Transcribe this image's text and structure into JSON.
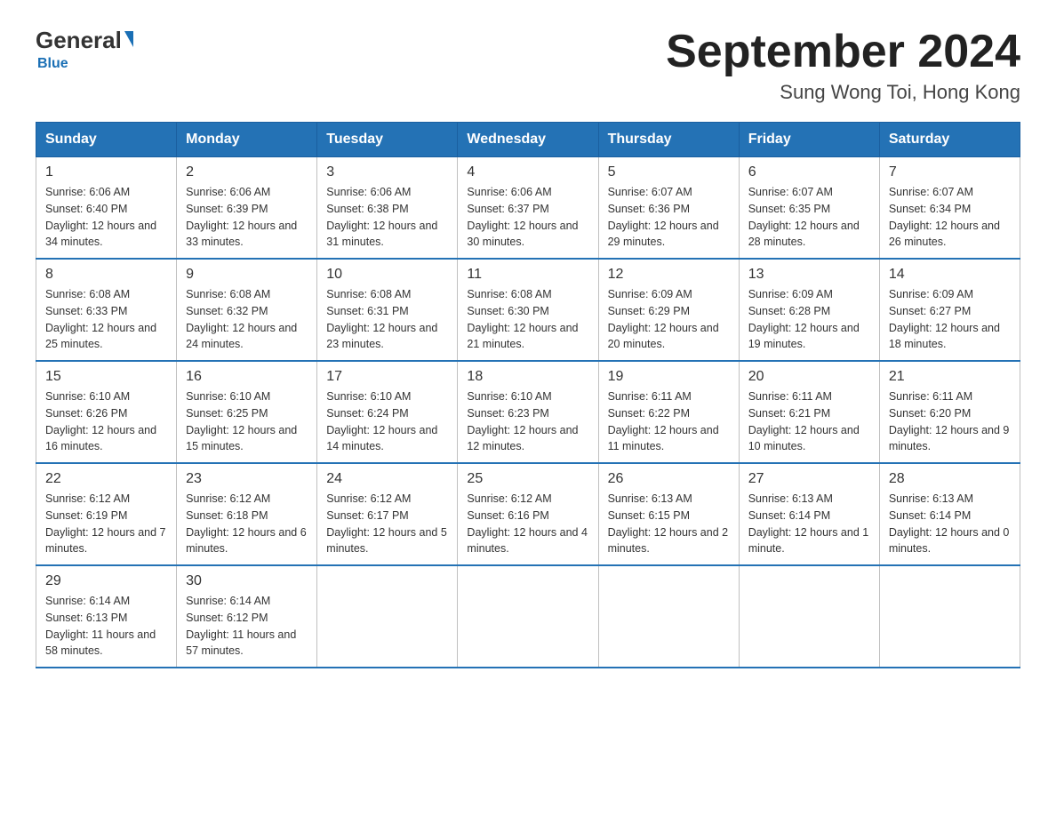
{
  "header": {
    "logo_general": "General",
    "logo_blue": "Blue",
    "month_year": "September 2024",
    "location": "Sung Wong Toi, Hong Kong"
  },
  "weekdays": [
    "Sunday",
    "Monday",
    "Tuesday",
    "Wednesday",
    "Thursday",
    "Friday",
    "Saturday"
  ],
  "weeks": [
    [
      {
        "day": "1",
        "sunrise": "6:06 AM",
        "sunset": "6:40 PM",
        "daylight": "12 hours and 34 minutes."
      },
      {
        "day": "2",
        "sunrise": "6:06 AM",
        "sunset": "6:39 PM",
        "daylight": "12 hours and 33 minutes."
      },
      {
        "day": "3",
        "sunrise": "6:06 AM",
        "sunset": "6:38 PM",
        "daylight": "12 hours and 31 minutes."
      },
      {
        "day": "4",
        "sunrise": "6:06 AM",
        "sunset": "6:37 PM",
        "daylight": "12 hours and 30 minutes."
      },
      {
        "day": "5",
        "sunrise": "6:07 AM",
        "sunset": "6:36 PM",
        "daylight": "12 hours and 29 minutes."
      },
      {
        "day": "6",
        "sunrise": "6:07 AM",
        "sunset": "6:35 PM",
        "daylight": "12 hours and 28 minutes."
      },
      {
        "day": "7",
        "sunrise": "6:07 AM",
        "sunset": "6:34 PM",
        "daylight": "12 hours and 26 minutes."
      }
    ],
    [
      {
        "day": "8",
        "sunrise": "6:08 AM",
        "sunset": "6:33 PM",
        "daylight": "12 hours and 25 minutes."
      },
      {
        "day": "9",
        "sunrise": "6:08 AM",
        "sunset": "6:32 PM",
        "daylight": "12 hours and 24 minutes."
      },
      {
        "day": "10",
        "sunrise": "6:08 AM",
        "sunset": "6:31 PM",
        "daylight": "12 hours and 23 minutes."
      },
      {
        "day": "11",
        "sunrise": "6:08 AM",
        "sunset": "6:30 PM",
        "daylight": "12 hours and 21 minutes."
      },
      {
        "day": "12",
        "sunrise": "6:09 AM",
        "sunset": "6:29 PM",
        "daylight": "12 hours and 20 minutes."
      },
      {
        "day": "13",
        "sunrise": "6:09 AM",
        "sunset": "6:28 PM",
        "daylight": "12 hours and 19 minutes."
      },
      {
        "day": "14",
        "sunrise": "6:09 AM",
        "sunset": "6:27 PM",
        "daylight": "12 hours and 18 minutes."
      }
    ],
    [
      {
        "day": "15",
        "sunrise": "6:10 AM",
        "sunset": "6:26 PM",
        "daylight": "12 hours and 16 minutes."
      },
      {
        "day": "16",
        "sunrise": "6:10 AM",
        "sunset": "6:25 PM",
        "daylight": "12 hours and 15 minutes."
      },
      {
        "day": "17",
        "sunrise": "6:10 AM",
        "sunset": "6:24 PM",
        "daylight": "12 hours and 14 minutes."
      },
      {
        "day": "18",
        "sunrise": "6:10 AM",
        "sunset": "6:23 PM",
        "daylight": "12 hours and 12 minutes."
      },
      {
        "day": "19",
        "sunrise": "6:11 AM",
        "sunset": "6:22 PM",
        "daylight": "12 hours and 11 minutes."
      },
      {
        "day": "20",
        "sunrise": "6:11 AM",
        "sunset": "6:21 PM",
        "daylight": "12 hours and 10 minutes."
      },
      {
        "day": "21",
        "sunrise": "6:11 AM",
        "sunset": "6:20 PM",
        "daylight": "12 hours and 9 minutes."
      }
    ],
    [
      {
        "day": "22",
        "sunrise": "6:12 AM",
        "sunset": "6:19 PM",
        "daylight": "12 hours and 7 minutes."
      },
      {
        "day": "23",
        "sunrise": "6:12 AM",
        "sunset": "6:18 PM",
        "daylight": "12 hours and 6 minutes."
      },
      {
        "day": "24",
        "sunrise": "6:12 AM",
        "sunset": "6:17 PM",
        "daylight": "12 hours and 5 minutes."
      },
      {
        "day": "25",
        "sunrise": "6:12 AM",
        "sunset": "6:16 PM",
        "daylight": "12 hours and 4 minutes."
      },
      {
        "day": "26",
        "sunrise": "6:13 AM",
        "sunset": "6:15 PM",
        "daylight": "12 hours and 2 minutes."
      },
      {
        "day": "27",
        "sunrise": "6:13 AM",
        "sunset": "6:14 PM",
        "daylight": "12 hours and 1 minute."
      },
      {
        "day": "28",
        "sunrise": "6:13 AM",
        "sunset": "6:14 PM",
        "daylight": "12 hours and 0 minutes."
      }
    ],
    [
      {
        "day": "29",
        "sunrise": "6:14 AM",
        "sunset": "6:13 PM",
        "daylight": "11 hours and 58 minutes."
      },
      {
        "day": "30",
        "sunrise": "6:14 AM",
        "sunset": "6:12 PM",
        "daylight": "11 hours and 57 minutes."
      },
      null,
      null,
      null,
      null,
      null
    ]
  ]
}
